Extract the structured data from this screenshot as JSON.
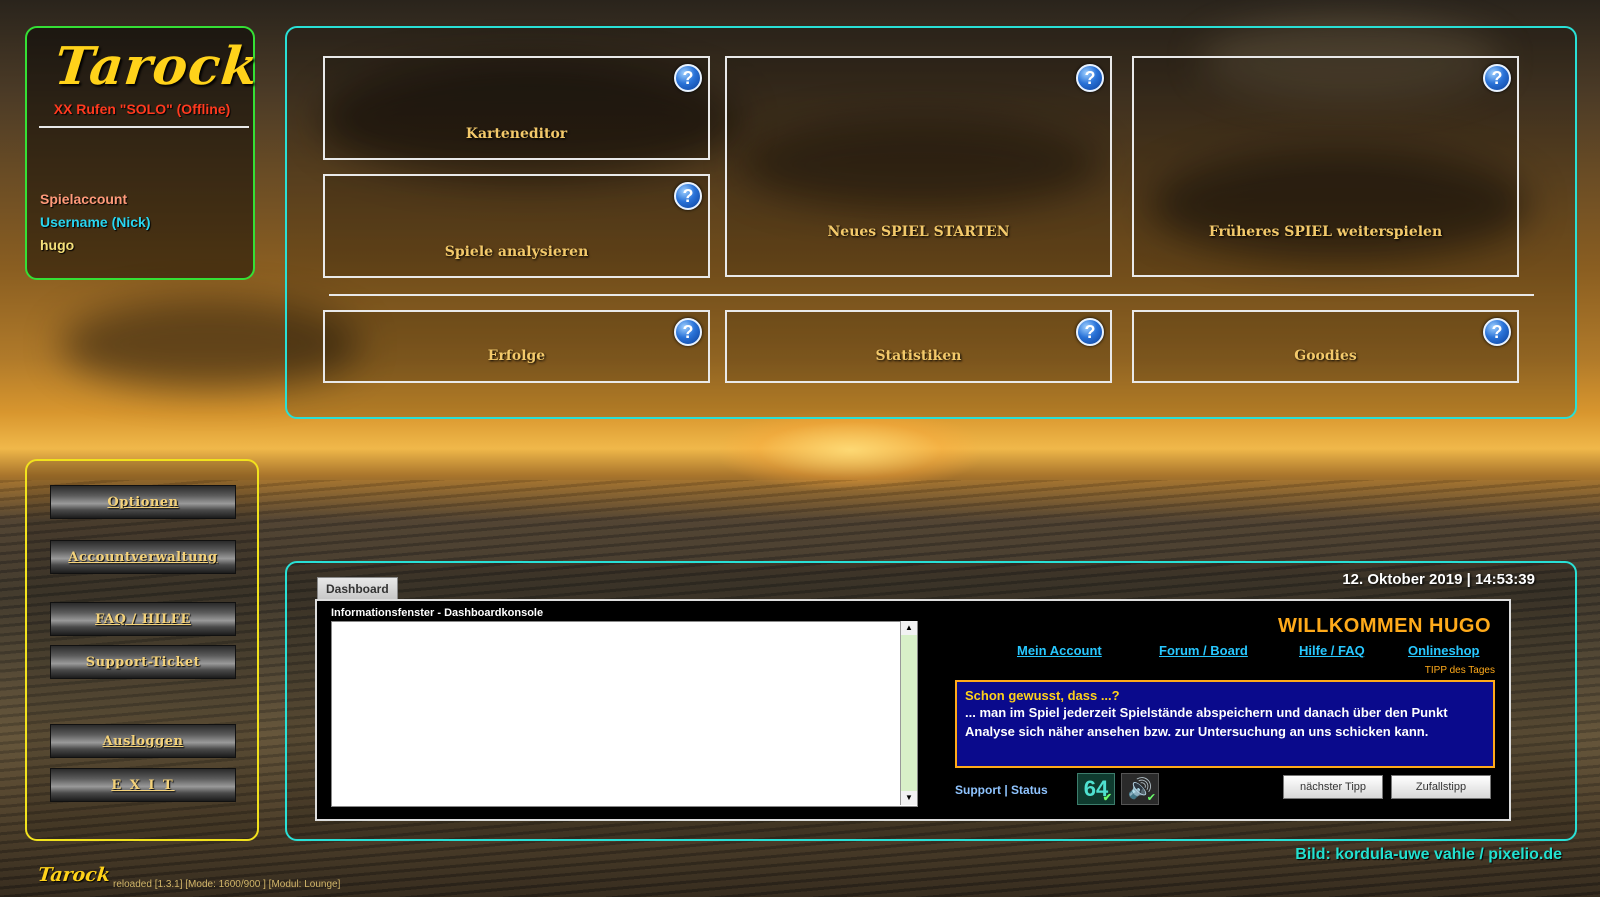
{
  "brand": {
    "logo": "Tarock",
    "subtitle": "XX Rufen \"SOLO\" (Offline)"
  },
  "account": {
    "title": "Spielaccount",
    "username_label": "Username (Nick)",
    "username": "hugo"
  },
  "menu": {
    "tiles": [
      {
        "label": "Karteneditor"
      },
      {
        "label": "Neues SPIEL STARTEN"
      },
      {
        "label": "Früheres SPIEL weiterspielen"
      },
      {
        "label": "Spiele analysieren"
      },
      {
        "label": "Erfolge"
      },
      {
        "label": "Statistiken"
      },
      {
        "label": "Goodies"
      }
    ],
    "help_glyph": "?"
  },
  "side_menu": {
    "items": [
      {
        "label": "Optionen"
      },
      {
        "label": "Accountverwaltung"
      },
      {
        "label": "FAQ / HILFE"
      },
      {
        "label": "Support-Ticket"
      },
      {
        "label": "Ausloggen"
      },
      {
        "label": "E X I T"
      }
    ]
  },
  "dashboard": {
    "tab": "Dashboard",
    "datetime": "12. Oktober 2019 | 14:53:39",
    "console_title": "Informationsfenster - Dashboardkonsole",
    "welcome": "WILLKOMMEN  HUGO",
    "links": [
      "Mein Account",
      "Forum / Board",
      "Hilfe / FAQ",
      "Onlineshop"
    ],
    "tipp_label": "TIPP des Tages",
    "tip_question": "Schon gewusst, dass ...?",
    "tip_text": "... man im Spiel jederzeit Spielstände abspeichern und danach über den Punkt Analyse sich näher ansehen bzw. zur Untersuchung an uns schicken kann.",
    "support": "Support | Status",
    "badge_64": "64",
    "sound_glyph": "🔊",
    "check_glyph": "✔",
    "next_tip": "nächster Tipp",
    "random_tip": "Zufallstipp"
  },
  "footer": {
    "credit": "Bild: kordula-uwe vahle / pixelio.de",
    "logo": "Tarock",
    "info": "reloaded [1.3.1] [Mode: 1600/900 ] [Modul: Lounge]"
  }
}
